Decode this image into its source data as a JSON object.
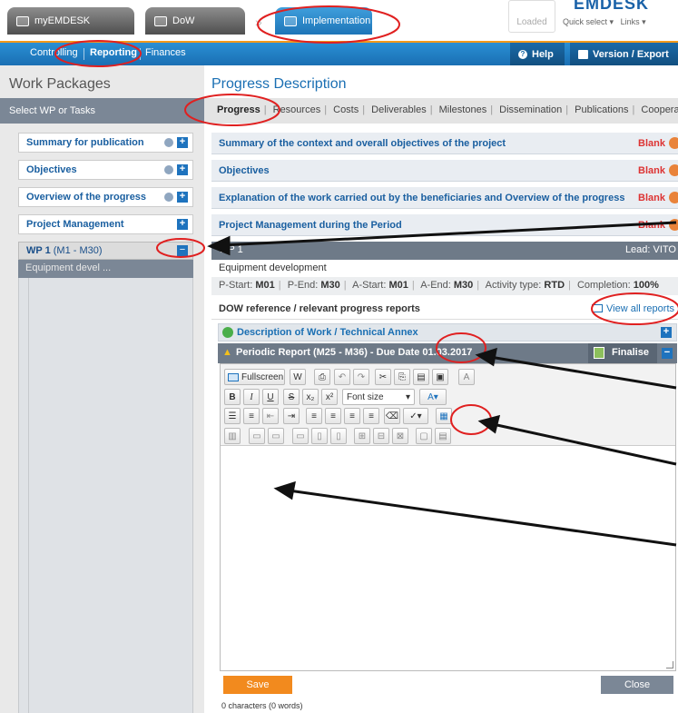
{
  "top": {
    "tabs": [
      {
        "label": "myEMDESK",
        "icon": "window-icon"
      },
      {
        "label": "DoW",
        "icon": "document-icon"
      },
      {
        "label": "Implementation",
        "icon": "document-icon"
      }
    ],
    "loaded": "Loaded",
    "brand": "EMDESK",
    "quick_select": "Quick select",
    "links": "Links"
  },
  "nav": {
    "items": [
      "Controlling",
      "Reporting",
      "Finances"
    ],
    "help": "Help",
    "version_export": "Version / Export"
  },
  "left": {
    "title": "Work Packages",
    "select": "Select WP or Tasks",
    "items": [
      {
        "label": "Summary for publication",
        "has_help": true
      },
      {
        "label": "Objectives",
        "has_help": true
      },
      {
        "label": "Overview of the progress",
        "has_help": true
      },
      {
        "label": "Project Management",
        "has_help": false
      }
    ],
    "wp1_label": "WP 1",
    "wp1_period": "(M1 - M30)",
    "wp1_sub": "Equipment devel ..."
  },
  "main": {
    "title": "Progress Description",
    "tabs": [
      "Progress",
      "Resources",
      "Costs",
      "Deliverables",
      "Milestones",
      "Dissemination",
      "Publications",
      "Cooperation"
    ],
    "sections": [
      {
        "label": "Summary of the context and overall objectives of the project",
        "status": "Blank"
      },
      {
        "label": "Objectives",
        "status": "Blank"
      },
      {
        "label": "Explanation of the work carried out by the beneficiaries and Overview of the progress",
        "status": "Blank"
      },
      {
        "label": "Project Management during the Period",
        "status": "Blank"
      }
    ],
    "wp_bar_left": "WP 1",
    "lead": "Lead: VITO",
    "wp_name": "Equipment development",
    "meta": {
      "p_start_label": "P-Start:",
      "p_start": "M01",
      "p_end_label": "P-End:",
      "p_end": "M30",
      "a_start_label": "A-Start:",
      "a_start": "M01",
      "a_end_label": "A-End:",
      "a_end": "M30",
      "activity_label": "Activity type:",
      "activity": "RTD",
      "completion_label": "Completion:",
      "completion": "100%"
    },
    "dow_ref": "DOW reference / relevant progress reports",
    "view_all": "View all reports",
    "description": "Description of Work / Technical Annex",
    "periodic": "Periodic Report (M25 - M36) - Due Date 01.03.2017",
    "finalise": "Finalise",
    "fullscreen": "Fullscreen",
    "font_size": "Font size",
    "save": "Save",
    "close": "Close",
    "char_count": "0 characters (0 words)"
  },
  "colors": {
    "accent": "#1a6fb3",
    "orange": "#f28a1e",
    "annotation": "#e02020"
  }
}
